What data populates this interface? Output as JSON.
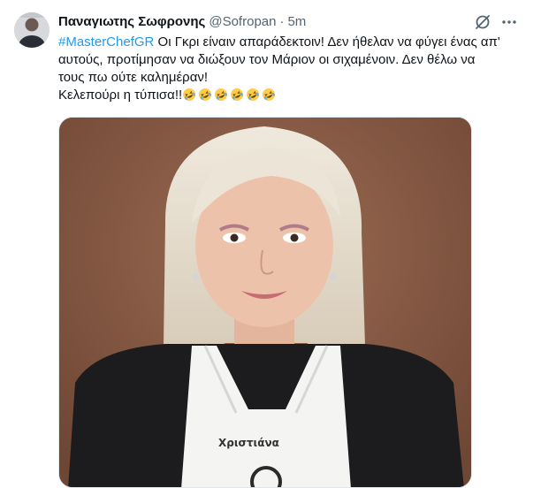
{
  "tweet": {
    "author_name": "Παναγιωτης Σωφρονης",
    "author_handle": "@Sofropan",
    "separator": "·",
    "time": "5m",
    "hashtag": "#MasterChefGR",
    "line1": " Οι Γκρι είναιν απαράδεκτοιν! Δεν ήθελαν να φύγει ένας απ'",
    "line2": "αυτούς, προτίμησαν να διώξουν τον Μάριον οι σιχαμένοιν. Δεν θέλω να",
    "line3": "τους πω ούτε καλημέραν!",
    "line4": "Κελεπούρι η τύπισα!!",
    "emoji_count": 6,
    "emoji": "rolling-on-floor-laughing"
  },
  "media": {
    "apron_name": "Χριστιάνα"
  },
  "colors": {
    "link": "#1d9bf0",
    "secondary_text": "#536471",
    "photo_background": "#8a5d46"
  }
}
